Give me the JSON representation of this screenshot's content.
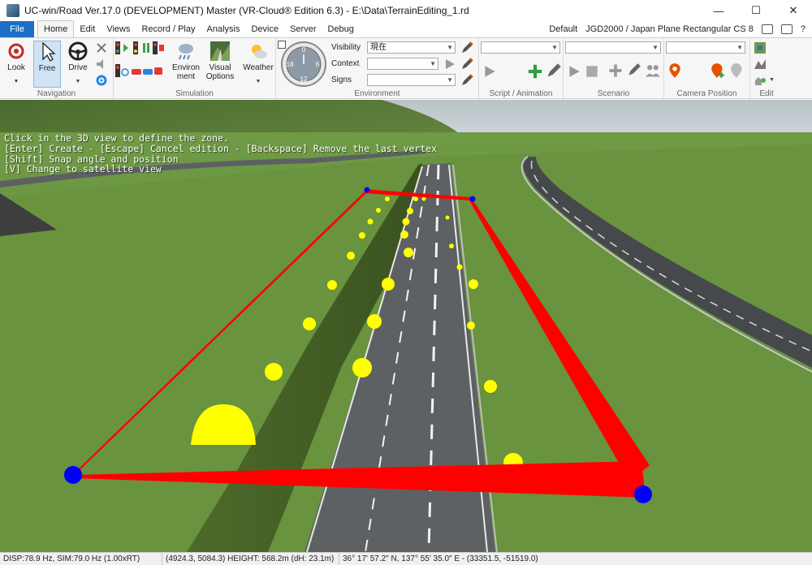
{
  "window": {
    "title": "UC-win/Road Ver.17.0 (DEVELOPMENT) Master (VR-Cloud® Edition 6.3) - E:\\Data\\TerrainEditing_1.rd",
    "minimize": "—",
    "maximize": "☐",
    "close": "✕"
  },
  "tabs": {
    "file": "File",
    "items": [
      "Home",
      "Edit",
      "Views",
      "Record / Play",
      "Analysis",
      "Device",
      "Server",
      "Debug"
    ],
    "active": "Home"
  },
  "right_info": {
    "profile": "Default",
    "crs": "JGD2000 / Japan Plane Rectangular CS 8"
  },
  "ribbon": {
    "navigation": {
      "label": "Navigation",
      "look": "Look",
      "free": "Free",
      "drive": "Drive"
    },
    "simulation": {
      "label": "Simulation",
      "environment": "Environ ment",
      "visual_options": "Visual Options",
      "weather": "Weather"
    },
    "environment": {
      "label": "Environment",
      "visibility_label": "Visibility",
      "visibility_value": "現在",
      "context_label": "Context",
      "context_value": "",
      "signs_label": "Signs",
      "signs_value": "",
      "clock_numbers": [
        "0",
        "6",
        "12",
        "18"
      ]
    },
    "script_animation": {
      "label": "Script / Animation"
    },
    "scenario": {
      "label": "Scenario"
    },
    "camera_position": {
      "label": "Camera Position"
    },
    "edit": {
      "label": "Edit"
    }
  },
  "viewport": {
    "instructions": [
      "Click in the 3D view to define the zone.",
      "[Enter] Create - [Escape] Cancel edition - [Backspace] Remove the last vertex",
      "[Shift] Snap angle and position",
      "[V] Change to satellite view"
    ],
    "colors": {
      "zone_edge": "#ff0000",
      "vertex": "#0000ff",
      "marker": "#ffff00"
    }
  },
  "status": {
    "rates": "DISP:78.9 Hz, SIM:79.0 Hz (1.00xRT)",
    "position": "(4924.3, 5084.3) HEIGHT: 568.2m (dH: 23.1m)",
    "latlon": "36° 17' 57.2\" N, 137° 55' 35.0\" E - (33351.5, -51519.0)"
  }
}
